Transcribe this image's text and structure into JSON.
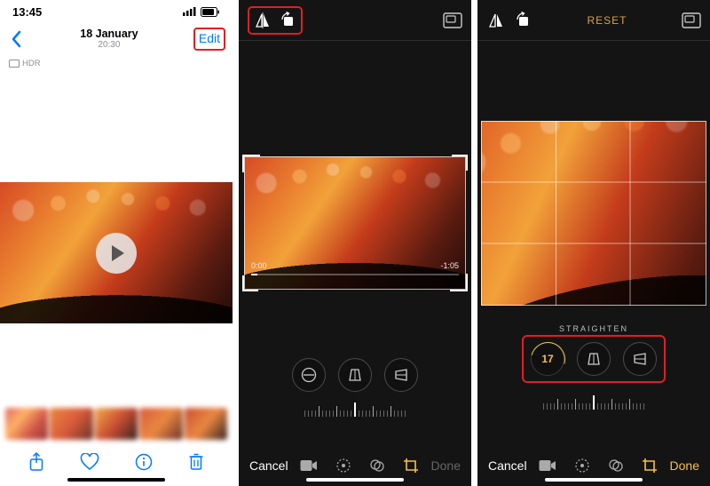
{
  "screen1": {
    "status_time": "13:45",
    "title_date": "18 January",
    "title_time": "20:30",
    "edit_label": "Edit",
    "hdr_label": "HDR"
  },
  "screen2": {
    "trim_start": "0:00",
    "trim_end": "-1:05",
    "cancel_label": "Cancel",
    "done_label": "Done"
  },
  "screen3": {
    "reset_label": "RESET",
    "straighten_label": "STRAIGHTEN",
    "straighten_value": "17",
    "cancel_label": "Cancel",
    "done_label": "Done"
  },
  "icons": {
    "flip": "flip-horizontal-icon",
    "rotate": "rotate-icon",
    "aspect": "aspect-ratio-icon"
  }
}
